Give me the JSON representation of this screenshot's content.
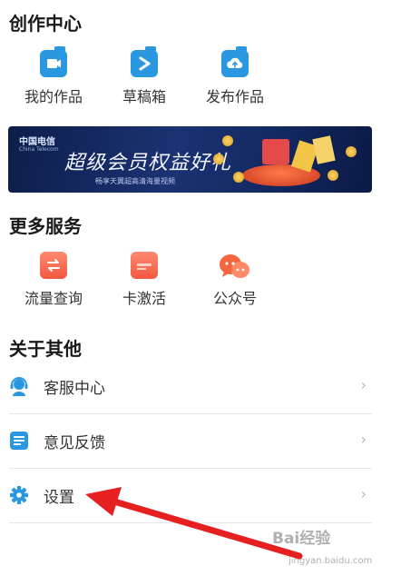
{
  "creation": {
    "title": "创作中心",
    "items": [
      {
        "label": "我的作品",
        "icon": "video-folder-icon"
      },
      {
        "label": "草稿箱",
        "icon": "play-folder-icon"
      },
      {
        "label": "发布作品",
        "icon": "upload-folder-icon"
      }
    ]
  },
  "banner": {
    "logo": "中国电信",
    "logo_sub": "China Telecom",
    "headline": "超级会员权益好礼",
    "subtext": "畅享天翼超高清海量视频"
  },
  "services": {
    "title": "更多服务",
    "items": [
      {
        "label": "流量查询",
        "icon": "data-query-icon"
      },
      {
        "label": "卡激活",
        "icon": "card-activate-icon"
      },
      {
        "label": "公众号",
        "icon": "chat-bubbles-icon"
      }
    ]
  },
  "about": {
    "title": "关于其他",
    "rows": [
      {
        "label": "客服中心",
        "icon": "headset-icon"
      },
      {
        "label": "意见反馈",
        "icon": "feedback-icon"
      },
      {
        "label": "设置",
        "icon": "gear-icon"
      }
    ]
  },
  "watermark": {
    "text": "Bai经验",
    "sub": "jingyan.baidu.com"
  },
  "colors": {
    "blue": "#2a98e0",
    "coral": "#f2583e",
    "arrow": "#e62020"
  }
}
